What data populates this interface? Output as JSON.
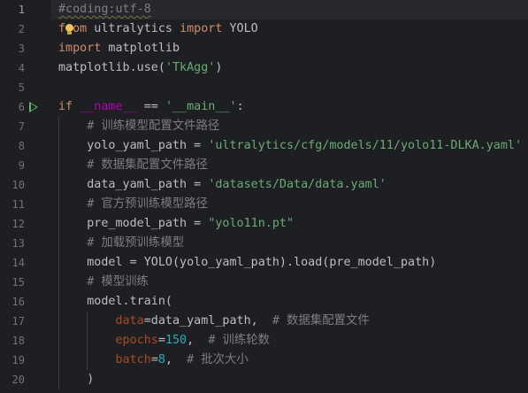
{
  "editor": {
    "lines": [
      {
        "n": "1",
        "tokens": [
          {
            "t": "#coding:utf-8",
            "c": "c-comment squiggle"
          }
        ]
      },
      {
        "n": "2",
        "tokens": [
          {
            "t": "from",
            "c": "c-kw"
          },
          {
            "t": " ultralytics ",
            "c": "c-default"
          },
          {
            "t": "import",
            "c": "c-kw"
          },
          {
            "t": " YOLO",
            "c": "c-default"
          }
        ]
      },
      {
        "n": "3",
        "tokens": [
          {
            "t": "import",
            "c": "c-kw"
          },
          {
            "t": " matplotlib",
            "c": "c-default"
          }
        ]
      },
      {
        "n": "4",
        "tokens": [
          {
            "t": "matplotlib.use(",
            "c": "c-default"
          },
          {
            "t": "'TkAgg'",
            "c": "c-str"
          },
          {
            "t": ")",
            "c": "c-default"
          }
        ]
      },
      {
        "n": "5",
        "tokens": []
      },
      {
        "n": "6",
        "tokens": [
          {
            "t": "if",
            "c": "c-kw"
          },
          {
            "t": " ",
            "c": "c-default"
          },
          {
            "t": "__name__",
            "c": "c-dunder"
          },
          {
            "t": " == ",
            "c": "c-default"
          },
          {
            "t": "'__main__'",
            "c": "c-str"
          },
          {
            "t": ":",
            "c": "c-default"
          }
        ]
      },
      {
        "n": "7",
        "tokens": [
          {
            "t": "    ",
            "c": "c-default"
          },
          {
            "t": "# 训练模型配置文件路径",
            "c": "c-comment"
          }
        ]
      },
      {
        "n": "8",
        "tokens": [
          {
            "t": "    yolo_yaml_path = ",
            "c": "c-default"
          },
          {
            "t": "'ultralytics/cfg/models/11/yolo11-DLKA.yaml'",
            "c": "c-str"
          }
        ]
      },
      {
        "n": "9",
        "tokens": [
          {
            "t": "    ",
            "c": "c-default"
          },
          {
            "t": "# 数据集配置文件路径",
            "c": "c-comment"
          }
        ]
      },
      {
        "n": "10",
        "tokens": [
          {
            "t": "    data_yaml_path = ",
            "c": "c-default"
          },
          {
            "t": "'datasets/Data/data.yaml'",
            "c": "c-str"
          }
        ]
      },
      {
        "n": "11",
        "tokens": [
          {
            "t": "    ",
            "c": "c-default"
          },
          {
            "t": "# 官方预训练模型路径",
            "c": "c-comment"
          }
        ]
      },
      {
        "n": "12",
        "tokens": [
          {
            "t": "    pre_model_path = ",
            "c": "c-default"
          },
          {
            "t": "\"yolo11n.pt\"",
            "c": "c-str"
          }
        ]
      },
      {
        "n": "13",
        "tokens": [
          {
            "t": "    ",
            "c": "c-default"
          },
          {
            "t": "# 加载预训练模型",
            "c": "c-comment"
          }
        ]
      },
      {
        "n": "14",
        "tokens": [
          {
            "t": "    model = YOLO(yolo_yaml_path).load(pre_model_path)",
            "c": "c-default"
          }
        ]
      },
      {
        "n": "15",
        "tokens": [
          {
            "t": "    ",
            "c": "c-default"
          },
          {
            "t": "# 模型训练",
            "c": "c-comment"
          }
        ]
      },
      {
        "n": "16",
        "tokens": [
          {
            "t": "    model.train(",
            "c": "c-default"
          }
        ]
      },
      {
        "n": "17",
        "tokens": [
          {
            "t": "        ",
            "c": "c-default"
          },
          {
            "t": "data",
            "c": "c-param"
          },
          {
            "t": "=data_yaml_path,  ",
            "c": "c-default"
          },
          {
            "t": "# 数据集配置文件",
            "c": "c-comment"
          }
        ]
      },
      {
        "n": "18",
        "tokens": [
          {
            "t": "        ",
            "c": "c-default"
          },
          {
            "t": "epochs",
            "c": "c-param"
          },
          {
            "t": "=",
            "c": "c-default"
          },
          {
            "t": "150",
            "c": "c-num"
          },
          {
            "t": ",  ",
            "c": "c-default"
          },
          {
            "t": "# 训练轮数",
            "c": "c-comment"
          }
        ]
      },
      {
        "n": "19",
        "tokens": [
          {
            "t": "        ",
            "c": "c-default"
          },
          {
            "t": "batch",
            "c": "c-param"
          },
          {
            "t": "=",
            "c": "c-default"
          },
          {
            "t": "8",
            "c": "c-num"
          },
          {
            "t": ",  ",
            "c": "c-default"
          },
          {
            "t": "# 批次大小",
            "c": "c-comment"
          }
        ]
      },
      {
        "n": "20",
        "tokens": [
          {
            "t": "    )",
            "c": "c-default"
          }
        ]
      }
    ]
  }
}
